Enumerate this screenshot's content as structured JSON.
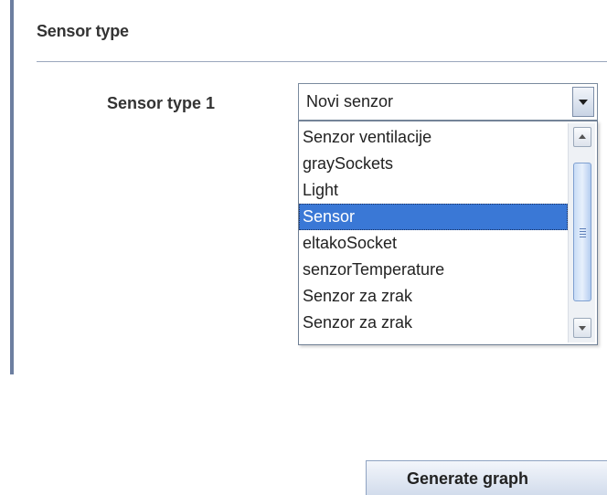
{
  "section": {
    "title": "Sensor type"
  },
  "field": {
    "label": "Sensor type 1"
  },
  "combo": {
    "selected_value": "Novi senzor"
  },
  "dropdown": {
    "options": [
      "Senzor ventilacije",
      "graySockets",
      "Light",
      "Sensor",
      "eltakoSocket",
      "senzorTemperature",
      "Senzor za zrak",
      "Senzor za zrak"
    ],
    "highlighted_option": "Sensor"
  },
  "actions": {
    "generate_label": "Generate graph"
  },
  "colors": {
    "highlight": "#3a78d6",
    "left_bar": "#6d7fa0",
    "separator": "#9aa6bc"
  },
  "icons": {
    "combo_arrow": "chevron-down-icon",
    "scroll_up": "arrow-up-icon",
    "scroll_down": "arrow-down-icon"
  }
}
